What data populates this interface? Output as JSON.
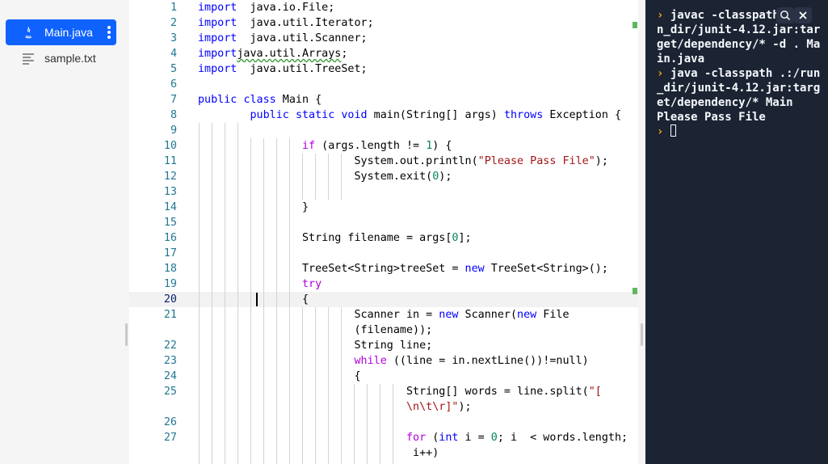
{
  "sidebar": {
    "files": [
      {
        "name": "Main.java",
        "icon": "java-file-icon",
        "active": true
      },
      {
        "name": "sample.txt",
        "icon": "text-file-icon",
        "active": false
      }
    ]
  },
  "editor": {
    "current_line": "20",
    "lines": [
      {
        "n": "1",
        "code": [
          [
            "kw",
            "import"
          ],
          [
            "",
            "  java.io.File;"
          ]
        ]
      },
      {
        "n": "2",
        "code": [
          [
            "kw",
            "import"
          ],
          [
            "",
            "  java.util.Iterator;"
          ]
        ]
      },
      {
        "n": "3",
        "code": [
          [
            "kw",
            "import"
          ],
          [
            "",
            "  java.util.Scanner;"
          ]
        ]
      },
      {
        "n": "4",
        "code": [
          [
            "kw",
            "import"
          ],
          [
            "",
            ""
          ],
          [
            "squiggle",
            "java.util.Arrays"
          ],
          [
            "",
            ";"
          ]
        ]
      },
      {
        "n": "5",
        "code": [
          [
            "kw",
            "import"
          ],
          [
            "",
            "  java.util.TreeSet;"
          ]
        ]
      },
      {
        "n": "6",
        "code": []
      },
      {
        "n": "7",
        "code": [
          [
            "kw",
            "public"
          ],
          [
            "",
            " "
          ],
          [
            "kw",
            "class"
          ],
          [
            "",
            " Main {"
          ]
        ]
      },
      {
        "n": "8",
        "code": [
          [
            "",
            "        "
          ],
          [
            "kw",
            "public"
          ],
          [
            "",
            " "
          ],
          [
            "kw",
            "static"
          ],
          [
            "",
            " "
          ],
          [
            "kw",
            "void"
          ],
          [
            "",
            " main(String[] args) "
          ],
          [
            "kw",
            "throws"
          ],
          [
            "",
            " Exception {"
          ]
        ]
      },
      {
        "n": "9",
        "code": []
      },
      {
        "n": "10",
        "code": [
          [
            "",
            "                "
          ],
          [
            "kc",
            "if"
          ],
          [
            "",
            " (args.length != "
          ],
          [
            "num",
            "1"
          ],
          [
            "",
            ") {"
          ]
        ]
      },
      {
        "n": "11",
        "code": [
          [
            "",
            "                        System.out.println("
          ],
          [
            "str",
            "\"Please Pass File\""
          ],
          [
            "",
            ");"
          ]
        ]
      },
      {
        "n": "12",
        "code": [
          [
            "",
            "                        System.exit("
          ],
          [
            "num",
            "0"
          ],
          [
            "",
            ");"
          ]
        ]
      },
      {
        "n": "13",
        "code": []
      },
      {
        "n": "14",
        "code": [
          [
            "",
            "                }"
          ]
        ]
      },
      {
        "n": "15",
        "code": []
      },
      {
        "n": "16",
        "code": [
          [
            "",
            "                String filename = args["
          ],
          [
            "num",
            "0"
          ],
          [
            "",
            "];"
          ]
        ]
      },
      {
        "n": "17",
        "code": []
      },
      {
        "n": "18",
        "code": [
          [
            "",
            "                TreeSet<String>treeSet = "
          ],
          [
            "kw",
            "new"
          ],
          [
            "",
            " TreeSet<String>();"
          ]
        ]
      },
      {
        "n": "19",
        "code": [
          [
            "",
            "                "
          ],
          [
            "kc",
            "try"
          ]
        ]
      },
      {
        "n": "20",
        "code": [
          [
            "",
            "                {"
          ]
        ]
      },
      {
        "n": "21",
        "code": [
          [
            "",
            "                        Scanner in = "
          ],
          [
            "kw",
            "new"
          ],
          [
            "",
            " Scanner("
          ],
          [
            "kw",
            "new"
          ],
          [
            "",
            " File"
          ]
        ]
      },
      {
        "n": "",
        "code": [
          [
            "",
            "                        (filename));"
          ]
        ]
      },
      {
        "n": "22",
        "code": [
          [
            "",
            "                        String line;"
          ]
        ]
      },
      {
        "n": "23",
        "code": [
          [
            "",
            "                        "
          ],
          [
            "kc",
            "while"
          ],
          [
            "",
            " ((line = in.nextLine())!=null)"
          ]
        ]
      },
      {
        "n": "24",
        "code": [
          [
            "",
            "                        {"
          ]
        ]
      },
      {
        "n": "25",
        "code": [
          [
            "",
            "                                String[] words = line.split("
          ],
          [
            "str",
            "\"["
          ]
        ]
      },
      {
        "n": "",
        "code": [
          [
            "",
            "                                "
          ],
          [
            "str",
            "\\n\\t\\r]\""
          ],
          [
            "",
            ");"
          ]
        ]
      },
      {
        "n": "26",
        "code": []
      },
      {
        "n": "27",
        "code": [
          [
            "",
            "                                "
          ],
          [
            "kc",
            "for"
          ],
          [
            "",
            " ("
          ],
          [
            "kw",
            "int"
          ],
          [
            "",
            " i = "
          ],
          [
            "num",
            "0"
          ],
          [
            "",
            "; i  < words.length;"
          ]
        ]
      },
      {
        "n": "",
        "code": [
          [
            "",
            "                                 i++)"
          ]
        ]
      }
    ]
  },
  "terminal": {
    "prompt_symbol": "›",
    "lines": [
      {
        "prompt": true,
        "text": "javac -classpath"
      },
      {
        "prompt": false,
        "text": "n_dir/junit-4.12.jar:tar"
      },
      {
        "prompt": false,
        "text": "get/dependency/* -d . Ma"
      },
      {
        "prompt": false,
        "text": "in.java"
      },
      {
        "prompt": true,
        "text": "java -classpath .:/run"
      },
      {
        "prompt": false,
        "text": "_dir/junit-4.12.jar:targ"
      },
      {
        "prompt": false,
        "text": "et/dependency/* Main"
      },
      {
        "prompt": false,
        "text": "Please Pass File"
      },
      {
        "prompt": true,
        "text": ""
      }
    ],
    "search_icon": "search-icon",
    "close_icon": "close-icon"
  }
}
